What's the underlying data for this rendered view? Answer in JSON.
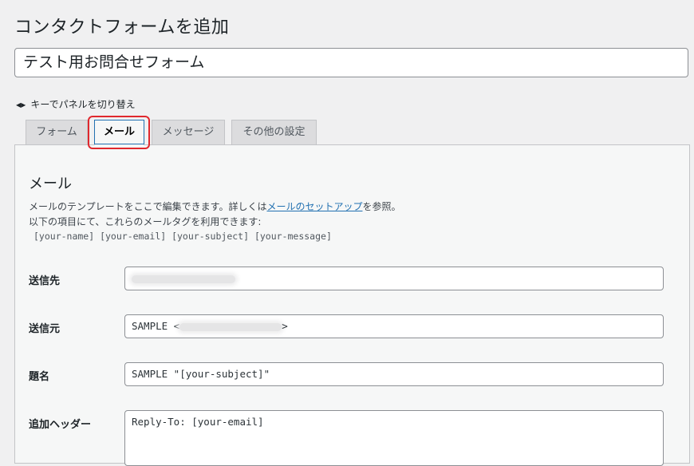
{
  "page": {
    "title": "コンタクトフォームを追加",
    "form_title_value": "テスト用お問合せフォーム"
  },
  "keyhint": {
    "text": "キーでパネルを切り替え",
    "icon": "left-right-arrows-icon"
  },
  "tabs": [
    {
      "label": "フォーム",
      "active": false
    },
    {
      "label": "メール",
      "active": true
    },
    {
      "label": "メッセージ",
      "active": false
    },
    {
      "label": "その他の設定",
      "active": false
    }
  ],
  "mail": {
    "heading": "メール",
    "description_prefix": "メールのテンプレートをここで編集できます。詳しくは",
    "description_link": "メールのセットアップ",
    "description_suffix": "を参照。",
    "tags_intro": "以下の項目にて、これらのメールタグを利用できます:",
    "tags": "[your-name] [your-email] [your-subject] [your-message]",
    "fields": {
      "to": {
        "label": "送信先",
        "value": ""
      },
      "from": {
        "label": "送信元",
        "value_prefix": "SAMPLE <",
        "value_suffix": ">"
      },
      "subject": {
        "label": "題名",
        "value": "SAMPLE \"[your-subject]\""
      },
      "headers": {
        "label": "追加ヘッダー",
        "value": "Reply-To: [your-email]"
      }
    }
  },
  "colors": {
    "highlight": "#e0282e",
    "link": "#2271b1",
    "background": "#f0f0f1"
  }
}
